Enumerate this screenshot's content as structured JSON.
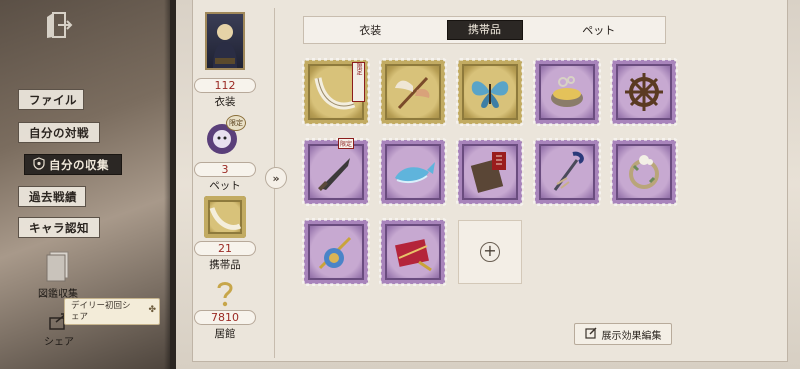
{
  "nav": {
    "items": [
      {
        "label": "ファイル"
      },
      {
        "label": "自分の対戦"
      },
      {
        "label": "自分の収集"
      },
      {
        "label": "過去戦績"
      },
      {
        "label": "キャラ認知"
      }
    ],
    "active": "自分の収集",
    "tools": [
      {
        "label": "図鑑収集",
        "icon": "book-icon"
      },
      {
        "label": "シェア",
        "icon": "share-icon"
      }
    ],
    "daily_tip": "デイリー初回シェア"
  },
  "summary": {
    "costume": {
      "count": "112",
      "label": "衣装"
    },
    "pet": {
      "count": "3",
      "label": "ペット",
      "badge": "限定"
    },
    "carry": {
      "count": "21",
      "label": "携帯品"
    },
    "residence": {
      "count": "7810",
      "label": "居館"
    }
  },
  "tabs": [
    {
      "label": "衣装",
      "active": false
    },
    {
      "label": "携帯品",
      "active": true
    },
    {
      "label": "ペット",
      "active": false
    }
  ],
  "items": [
    {
      "name": "horn-item",
      "frame": "gold",
      "tag": "限定"
    },
    {
      "name": "winged-item",
      "frame": "gold"
    },
    {
      "name": "butterfly-item",
      "frame": "gold"
    },
    {
      "name": "bowl-item",
      "frame": "purple"
    },
    {
      "name": "wheel-item",
      "frame": "purple"
    },
    {
      "name": "dagger-item",
      "frame": "purple",
      "tag": "限定"
    },
    {
      "name": "whale-item",
      "frame": "purple"
    },
    {
      "name": "book-item",
      "frame": "purple"
    },
    {
      "name": "cane-item",
      "frame": "purple"
    },
    {
      "name": "wreath-item",
      "frame": "purple"
    },
    {
      "name": "blade-item",
      "frame": "purple"
    },
    {
      "name": "case-item",
      "frame": "purple"
    }
  ],
  "edit_button": {
    "label": "展示効果編集"
  },
  "colors": {
    "accent_red": "#9b2a24",
    "tab_active": "#2b2724",
    "gold_frame": "#c2ab62",
    "purple_frame": "#a884bb"
  }
}
